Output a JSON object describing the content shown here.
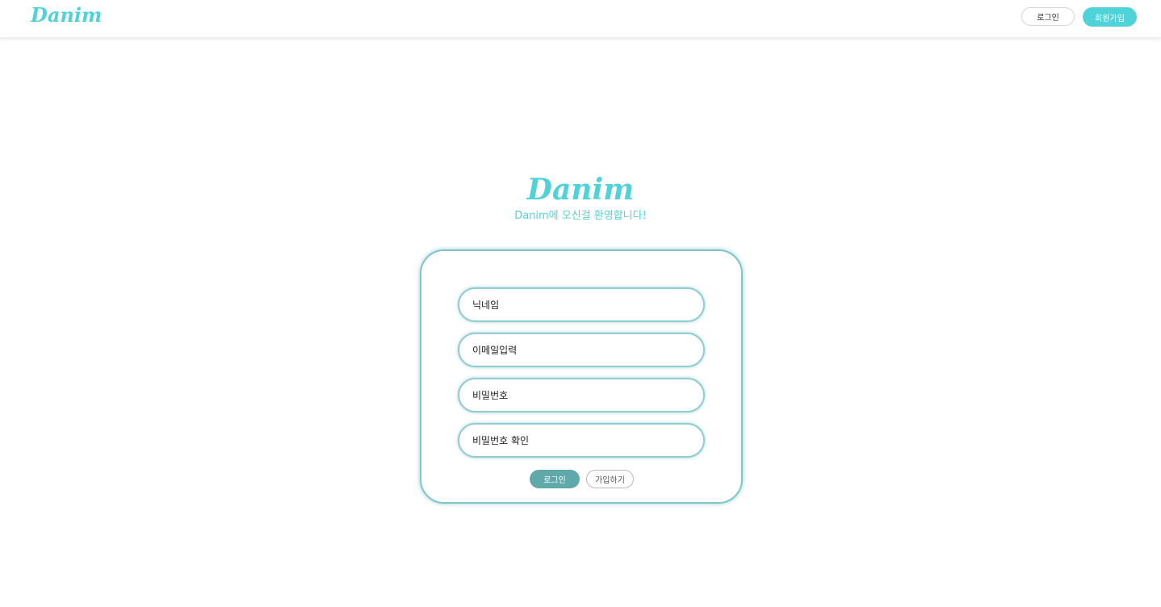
{
  "header": {
    "logo": "Danim",
    "login_label": "로그인",
    "signup_label": "회원가입"
  },
  "hero": {
    "title": "Danim",
    "subtitle": "Danim에 오신걸 환영합니다!"
  },
  "form": {
    "nickname_placeholder": "닉네임",
    "email_placeholder": "이메일입력",
    "password_placeholder": "비밀번호",
    "password_confirm_placeholder": "비밀번호 확인",
    "login_button": "로그인",
    "join_button": "가입하기"
  },
  "colors": {
    "accent": "#4fd3d8",
    "button_primary": "#5fa9aa",
    "card_border": "#7fc6c9"
  }
}
